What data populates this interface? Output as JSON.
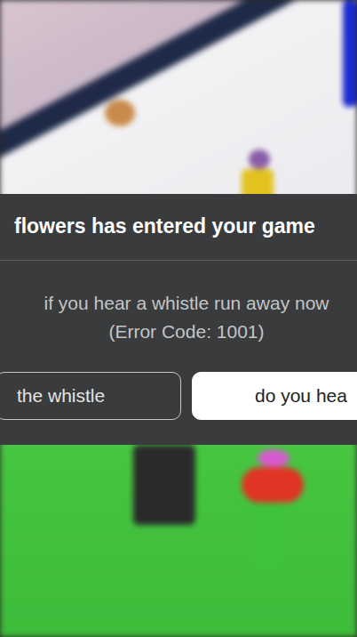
{
  "dialog": {
    "title": "flowers has entered your game",
    "message": "if you hear a whistle run away now",
    "error_code": "(Error Code: 1001)",
    "buttons": [
      {
        "label": "the whistle",
        "kind": "secondary"
      },
      {
        "label": "do you hea",
        "kind": "primary"
      }
    ]
  }
}
